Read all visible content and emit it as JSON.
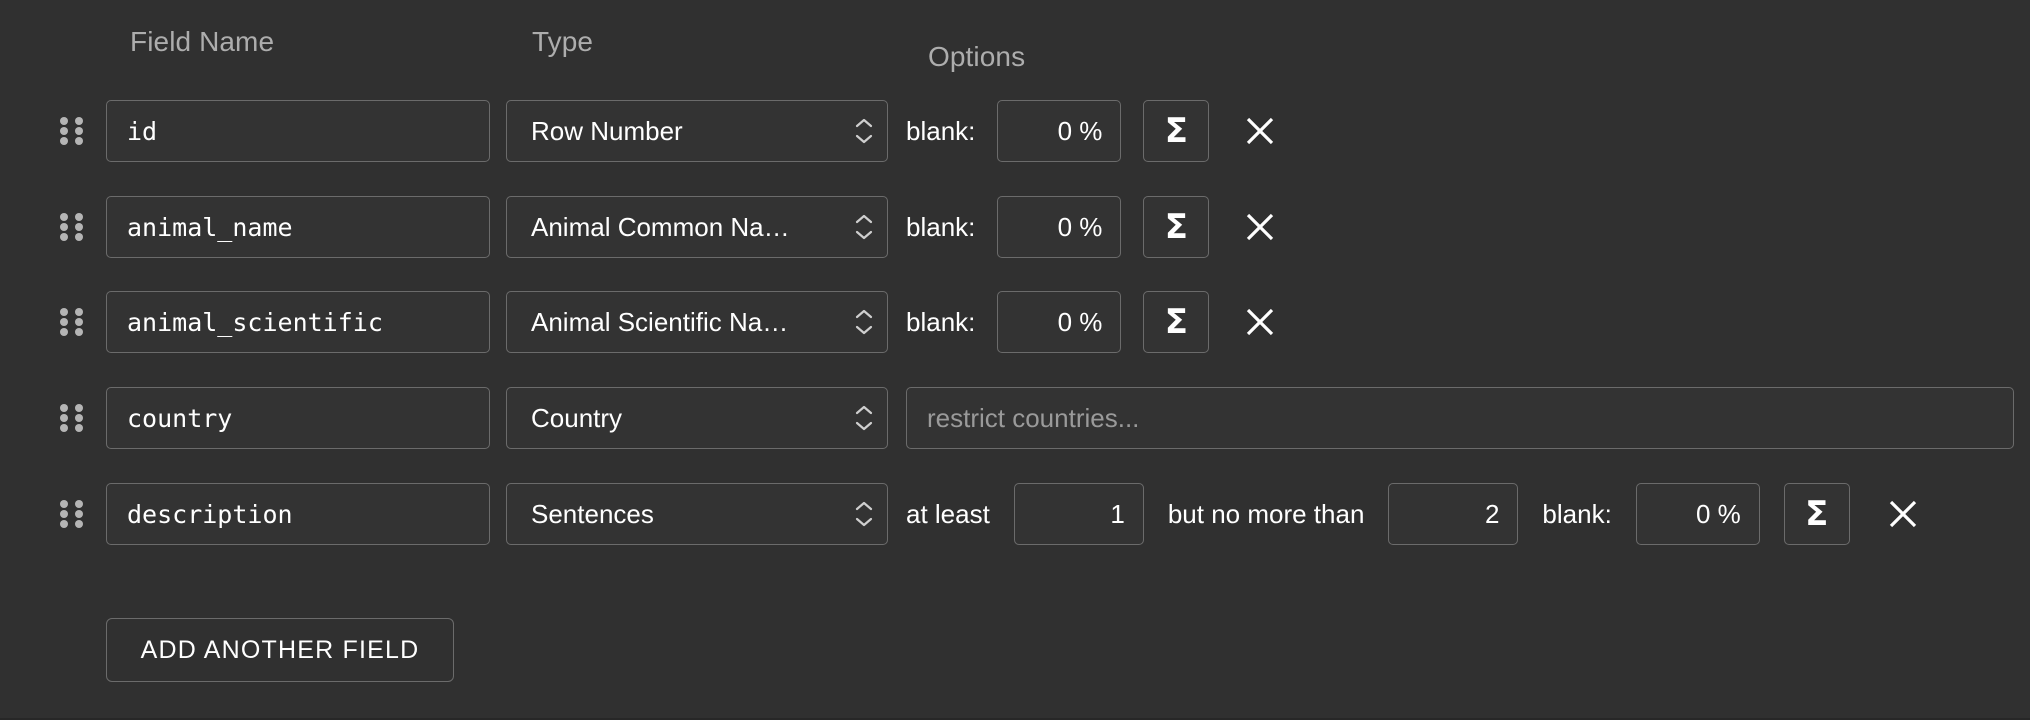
{
  "columns": {
    "field_name": "Field Name",
    "type": "Type",
    "options": "Options"
  },
  "labels": {
    "blank": "blank:",
    "at_least": "at least",
    "but_no_more_than": "but no more than",
    "sigma_glyph": "Σ",
    "add_another_field": "ADD ANOTHER FIELD",
    "restrict_countries_placeholder": "restrict countries..."
  },
  "rows": [
    {
      "name": "id",
      "type": "Row Number",
      "blank_label": "blank:",
      "blank_value": "0 %",
      "sigma": "Σ"
    },
    {
      "name": "animal_name",
      "type": "Animal Common Na…",
      "blank_label": "blank:",
      "blank_value": "0 %",
      "sigma": "Σ"
    },
    {
      "name": "animal_scientific",
      "type": "Animal Scientific Na…",
      "blank_label": "blank:",
      "blank_value": "0 %",
      "sigma": "Σ"
    },
    {
      "name": "country",
      "type": "Country",
      "restrict_placeholder": "restrict countries...",
      "restrict_value": ""
    },
    {
      "name": "description",
      "type": "Sentences",
      "at_least_label": "at least",
      "at_least_value": "1",
      "but_no_more_than_label": "but no more than",
      "but_no_more_than_value": "2",
      "blank_label": "blank:",
      "blank_value": "0 %",
      "sigma": "Σ"
    }
  ],
  "colors": {
    "background": "#303030",
    "control_fill": "#333333",
    "control_border": "#6b6b6b",
    "text": "#ffffff",
    "muted_text": "#adadad",
    "placeholder_text": "#9a9a9a",
    "handle_dot": "#b5b5b5"
  }
}
